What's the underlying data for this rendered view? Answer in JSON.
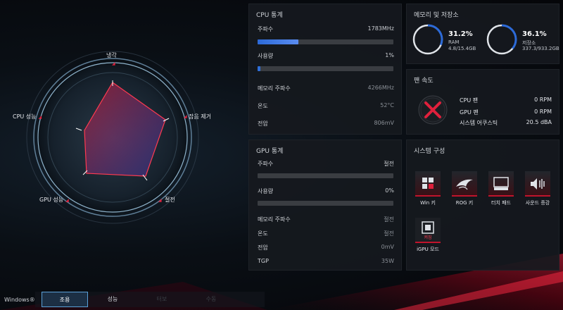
{
  "radar": {
    "labels": {
      "cooling": "냉각",
      "noise": "잡음 제거",
      "power": "절전",
      "gpu": "GPU 성능",
      "cpu": "CPU 성능"
    }
  },
  "cpu": {
    "title": "CPU 통계",
    "freq_label": "주파수",
    "freq_value": "1783MHz",
    "freq_bar": 0.3,
    "usage_label": "사용량",
    "usage_value": "1%",
    "usage_bar": 0.01,
    "mem_freq_label": "메모리 주파수",
    "mem_freq_value": "4266MHz",
    "temp_label": "온도",
    "temp_value": "52°C",
    "voltage_label": "전압",
    "voltage_value": "806mV"
  },
  "gpu": {
    "title": "GPU 통계",
    "freq_label": "주파수",
    "freq_value": "절전",
    "usage_label": "사용량",
    "usage_value": "0%",
    "mem_freq_label": "메모리 주파수",
    "mem_freq_value": "절전",
    "temp_label": "온도",
    "temp_value": "절전",
    "voltage_label": "전압",
    "voltage_value": "0mV",
    "tgp_label": "TGP",
    "tgp_value": "35W"
  },
  "memory": {
    "title": "메모리 및 저장소",
    "ram_percent": "31.2%",
    "ram_label": "RAM",
    "ram_detail": "4.8/15.4GB",
    "ram_fraction": 0.312,
    "storage_percent": "36.1%",
    "storage_label": "저장소",
    "storage_detail": "337.3/933.2GB",
    "storage_fraction": 0.361
  },
  "fan": {
    "title": "팬 속도",
    "cpu_fan_label": "CPU 팬",
    "cpu_fan_value": "0 RPM",
    "gpu_fan_label": "GPU 팬",
    "gpu_fan_value": "0 RPM",
    "acoustic_label": "시스템 어쿠스틱",
    "acoustic_value": "20.5 dBA"
  },
  "system": {
    "title": "시스템 구성",
    "tiles": [
      {
        "label": "Win 키",
        "icon": "windows-key-icon"
      },
      {
        "label": "ROG 키",
        "icon": "rog-key-icon"
      },
      {
        "label": "터치 패드",
        "icon": "touchpad-icon"
      },
      {
        "label": "사운드 증강",
        "icon": "sound-boost-icon"
      },
      {
        "label": "iGPU 모드",
        "icon": "igpu-icon",
        "badge": "켜짐"
      }
    ]
  },
  "bottom": {
    "windows_label": "Windows®",
    "modes": [
      "조용",
      "성능",
      "터보",
      "수동"
    ],
    "active_mode": "조용"
  },
  "colors": {
    "accent_red": "#e0203c",
    "accent_blue": "#2c6ad8",
    "panel_bg": "#16191e"
  }
}
